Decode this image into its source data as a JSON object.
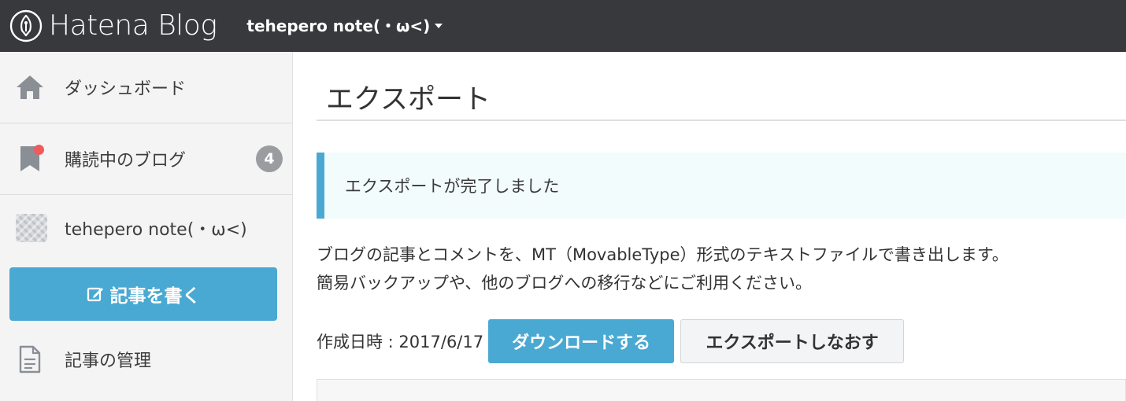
{
  "header": {
    "brand": "Hatena Blog",
    "blog_name": "tehepero note(・ω<)"
  },
  "sidebar": {
    "items": [
      {
        "label": "ダッシュボード",
        "icon": "home-icon"
      },
      {
        "label": "購読中のブログ",
        "icon": "bookmark-icon",
        "badge": "4",
        "has_notification_dot": true
      },
      {
        "label": "tehepero note(・ω<)",
        "icon": "blog-avatar"
      }
    ],
    "write_button": "記事を書く",
    "manage_label": "記事の管理"
  },
  "main": {
    "title": "エクスポート",
    "notice": "エクスポートが完了しました",
    "description_line1": "ブログの記事とコメントを、MT（MovableType）形式のテキストファイルで書き出します。",
    "description_line2": "簡易バックアップや、他のブログへの移行などにご利用ください。",
    "created_at": "作成日時 : 2017/6/17",
    "download_button": "ダウンロードする",
    "reexport_button": "エクスポートしなおす"
  },
  "colors": {
    "topbar": "#38393d",
    "accent": "#4aa9d2",
    "sidebar_bg": "#f4f4f5",
    "badge": "#9a9ca0",
    "notification_dot": "#f15a5a",
    "notice_bg": "#f2fcfc"
  }
}
